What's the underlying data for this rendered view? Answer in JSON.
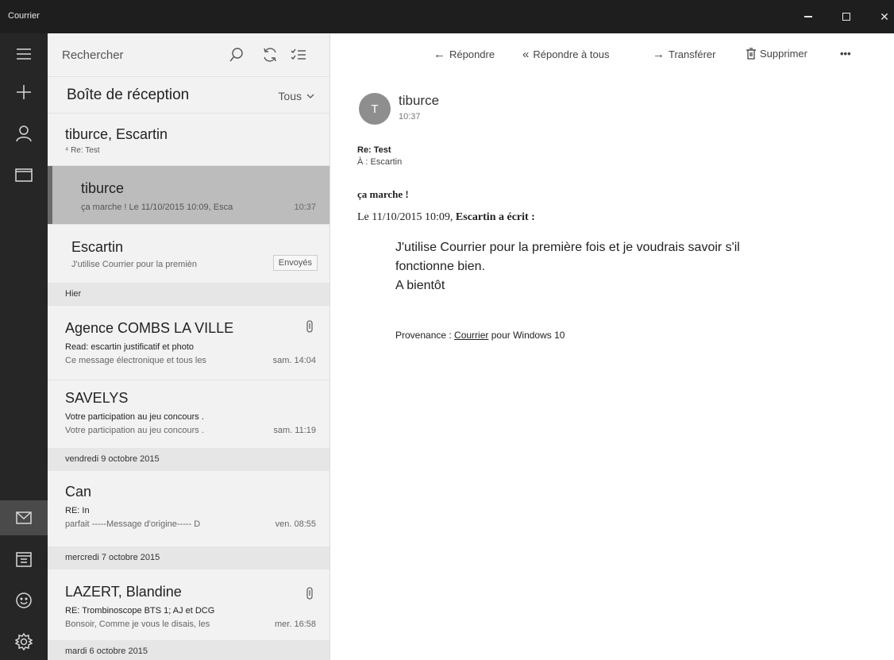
{
  "window": {
    "title": "Courrier",
    "minimize_glyph": "minimize-icon",
    "maximize_glyph": "maximize-icon",
    "close_label": "✕"
  },
  "rail": {
    "icons": [
      "hamburger-menu-icon",
      "compose-plus-icon",
      "person-accounts-icon",
      "folder-icon",
      "mail-icon",
      "calendar-icon",
      "smiley-feedback-icon",
      "settings-gear-icon"
    ],
    "active": "mail-icon"
  },
  "search": {
    "placeholder": "Rechercher"
  },
  "folder": {
    "title": "Boîte de réception",
    "filter": "Tous"
  },
  "messages": [
    {
      "sender": "tiburce, Escartin",
      "subject": "⁴ Re: Test"
    },
    {
      "sender": "tiburce",
      "preview": "ça marche ! Le 11/10/2015 10:09, Esca",
      "time": "10:37",
      "selected": true
    },
    {
      "sender": "Escartin",
      "preview": "J'utilise Courrier pour la premièn",
      "badge": "Envoyés"
    }
  ],
  "sections": [
    {
      "label": "Hier",
      "messages": [
        {
          "sender": "Agence COMBS LA VILLE",
          "subject": "Read: escartin justificatif et photo",
          "preview": "Ce message électronique et tous les",
          "time": "sam. 14:04",
          "attachment": true
        },
        {
          "sender": "SAVELYS",
          "subject": "Votre participation au jeu concours .",
          "preview": "Votre participation au jeu concours .",
          "time": "sam. 11:19"
        }
      ]
    },
    {
      "label": "vendredi 9 octobre 2015",
      "messages": [
        {
          "sender": "Can",
          "subject": "RE: In",
          "preview": "parfait -----Message d'origine----- D",
          "time": "ven. 08:55"
        }
      ]
    },
    {
      "label": "mercredi 7 octobre 2015",
      "messages": [
        {
          "sender": "LAZERT, Blandine",
          "subject": "RE: Trombinoscope BTS 1; AJ et DCG",
          "preview": "Bonsoir, Comme je vous le disais, les",
          "time": "mer. 16:58",
          "attachment": true
        }
      ]
    },
    {
      "label": "mardi 6 octobre 2015",
      "messages": []
    }
  ],
  "commands": {
    "reply": "Répondre",
    "reply_all": "Répondre à tous",
    "forward": "Transférer",
    "delete": "Supprimer",
    "more": "•••"
  },
  "reading": {
    "avatar_initial": "T",
    "from": "tiburce",
    "time": "10:37",
    "subject": "Re: Test",
    "to": "À : Escartin",
    "first_line": "ça marche !",
    "quote_header_prefix": "Le 11/10/2015 10:09, ",
    "quote_header_bold": "Escartin a écrit :",
    "quote_lines": [
      "J'utilise Courrier pour la première fois et je voudrais savoir s'il",
      "fonctionne bien.",
      "A bientôt"
    ],
    "signature_prefix": "Provenance : ",
    "signature_link": "Courrier",
    "signature_suffix": " pour Windows 10"
  }
}
